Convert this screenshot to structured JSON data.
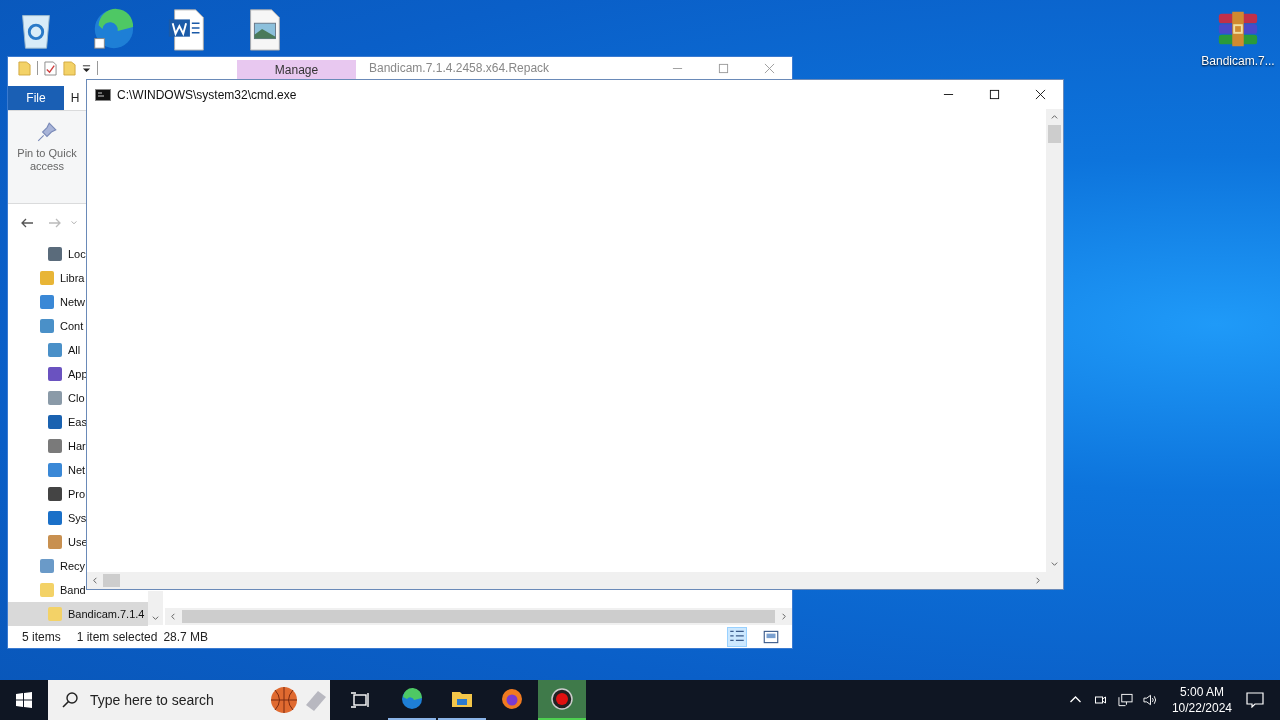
{
  "desktop_icons": [
    {
      "kind": "recycle-bin"
    },
    {
      "kind": "edge"
    },
    {
      "kind": "document"
    },
    {
      "kind": "image"
    },
    {
      "kind": "archive",
      "label": "Bandicam.7..."
    }
  ],
  "explorer": {
    "title": "Bandicam.7.1.4.2458.x64.Repack",
    "context_tab": "Manage",
    "ribbon_tabs": [
      {
        "label": "File",
        "kind": "file"
      },
      {
        "label": "H",
        "kind": "plain"
      }
    ],
    "ribbon_button": "Pin to Quick access",
    "nav_tree": {
      "scrolled_children": [
        {
          "label": "Loc",
          "kind": "drive"
        }
      ],
      "items": [
        {
          "label": "Libra",
          "kind": "library",
          "selected": false
        },
        {
          "label": "Netw",
          "kind": "network",
          "selected": false
        },
        {
          "label": "Cont",
          "kind": "control",
          "selected": false,
          "children": [
            {
              "label": "All",
              "kind": "control",
              "selected": false
            },
            {
              "label": "App",
              "kind": "apps",
              "selected": false
            },
            {
              "label": "Clo",
              "kind": "clock",
              "selected": false
            },
            {
              "label": "Eas",
              "kind": "ease",
              "selected": false
            },
            {
              "label": "Har",
              "kind": "printer",
              "selected": false
            },
            {
              "label": "Net",
              "kind": "network",
              "selected": false
            },
            {
              "label": "Pro",
              "kind": "program",
              "selected": false
            },
            {
              "label": "Sys",
              "kind": "system",
              "selected": false
            },
            {
              "label": "Use",
              "kind": "users",
              "selected": false
            }
          ]
        },
        {
          "label": "Recy",
          "kind": "recycle",
          "selected": false
        },
        {
          "label": "Band",
          "kind": "folder",
          "selected": false,
          "children": [
            {
              "label": "Bandicam.7.1.4",
              "kind": "folder",
              "selected": true
            }
          ]
        }
      ]
    },
    "status": {
      "count": "5 items",
      "selection": "1 item selected",
      "size": "28.7 MB"
    }
  },
  "cmd": {
    "title": "C:\\WINDOWS\\system32\\cmd.exe"
  },
  "taskbar": {
    "search_placeholder": "Type here to search",
    "apps": [
      {
        "kind": "edge",
        "running": true,
        "selected": false
      },
      {
        "kind": "explorer",
        "running": true,
        "selected": false
      },
      {
        "kind": "firefox",
        "running": false,
        "selected": false
      },
      {
        "kind": "recorder",
        "running": true,
        "selected": true
      }
    ],
    "time": "5:00 AM",
    "date": "10/22/2024"
  }
}
